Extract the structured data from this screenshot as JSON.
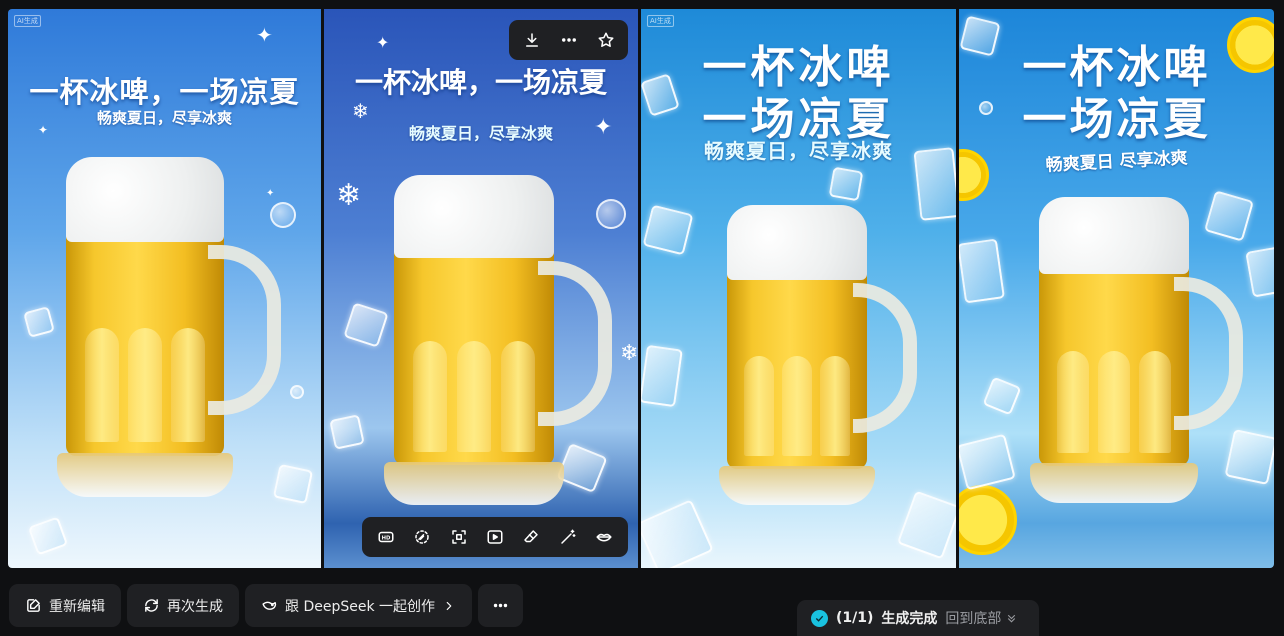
{
  "images": [
    {
      "headline": "一杯冰啤，一场凉夏",
      "subtitle": "畅爽夏日，尽享冰爽",
      "tag": "AI生成"
    },
    {
      "headline": "一杯冰啤，一场凉夏",
      "subtitle": "畅爽夏日，尽享冰爽",
      "tag": ""
    },
    {
      "headline_line1": "一杯冰啤",
      "headline_line2": "一场凉夏",
      "subtitle": "畅爽夏日，尽享冰爽",
      "tag": "AI生成"
    },
    {
      "headline_line1": "一杯冰啤",
      "headline_line2": "一场凉夏",
      "subtitle": "畅爽夏日 尽享冰爽",
      "tag": ""
    }
  ],
  "image_toolbar_top": {
    "icons": [
      "download-icon",
      "more-icon",
      "star-icon"
    ]
  },
  "image_toolbar_bottom": {
    "items": [
      {
        "icon": "hd-icon",
        "label": "HD"
      },
      {
        "icon": "erase-icon"
      },
      {
        "icon": "expand-icon"
      },
      {
        "icon": "play-icon"
      },
      {
        "icon": "eraser-icon"
      },
      {
        "icon": "magic-wand-icon"
      },
      {
        "icon": "lips-icon"
      }
    ]
  },
  "actions": {
    "reedit_label": "重新编辑",
    "regenerate_label": "再次生成",
    "deepseek_label": "跟 DeepSeek 一起创作"
  },
  "status": {
    "progress": "(1/1)",
    "text": "生成完成",
    "back_label": "回到底部",
    "accent": "#19c2e0"
  }
}
